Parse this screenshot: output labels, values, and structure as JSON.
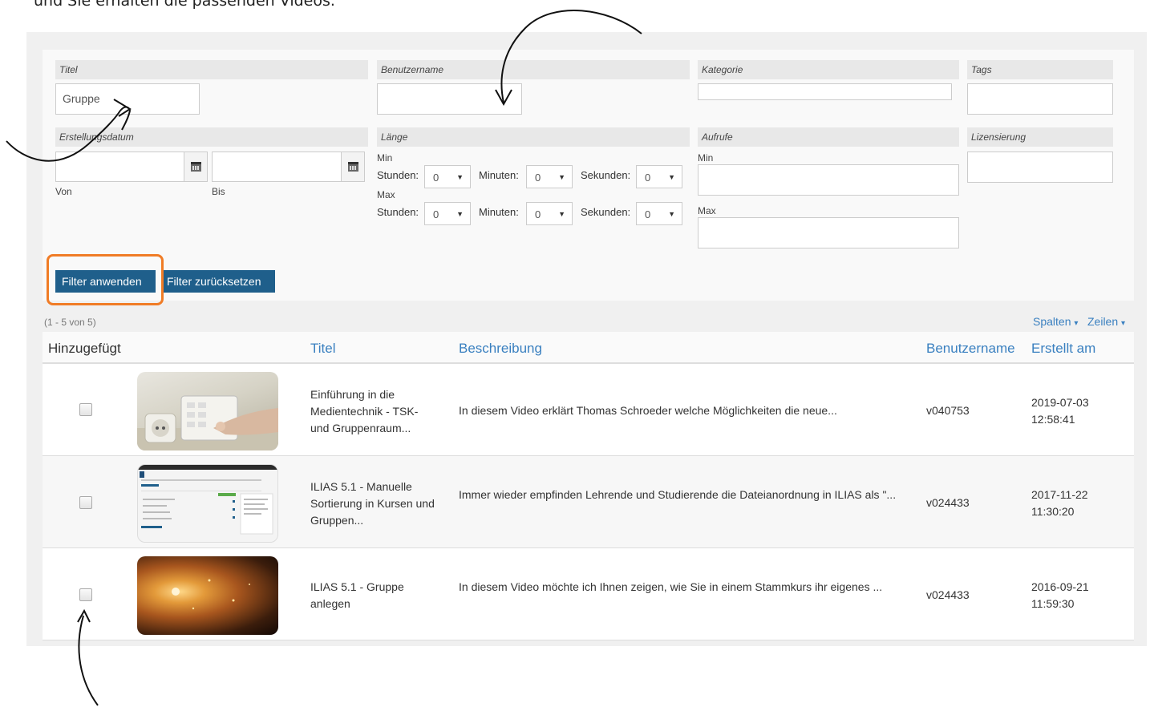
{
  "intro_text": "und Sie erhalten die passenden Videos.",
  "filter": {
    "title_label": "Titel",
    "title_value": "Gruppe",
    "username_label": "Benutzername",
    "username_value": "",
    "category_label": "Kategorie",
    "tags_label": "Tags",
    "created_label": "Erstellungsdatum",
    "from_label": "Von",
    "to_label": "Bis",
    "length_label": "Länge",
    "min_label": "Min",
    "max_label": "Max",
    "hours_label": "Stunden:",
    "minutes_label": "Minuten:",
    "seconds_label": "Sekunden:",
    "min_hours": "0",
    "min_minutes": "0",
    "min_seconds": "0",
    "max_hours": "0",
    "max_minutes": "0",
    "max_seconds": "0",
    "views_label": "Aufrufe",
    "views_min_label": "Min",
    "views_max_label": "Max",
    "license_label": "Lizensierung",
    "apply_label": "Filter anwenden",
    "reset_label": "Filter zurücksetzen"
  },
  "table": {
    "count": "(1 - 5 von 5)",
    "columns_label": "Spalten",
    "rows_label": "Zeilen",
    "headers": [
      "Hinzugefügt",
      "Titel",
      "Beschreibung",
      "Benutzername",
      "Erstellt am"
    ],
    "rows": [
      {
        "title": "Einführung in die Medientechnik - TSK- und Gruppenraum...",
        "description": "In diesem Video erklärt Thomas Schroeder welche Möglichkeiten die neue...",
        "username": "v040753",
        "date": "2019-07-03",
        "time": "12:58:41"
      },
      {
        "title": "ILIAS 5.1 - Manuelle Sortierung in Kursen und Gruppen...",
        "description": "Immer wieder empfinden Lehrende und Studierende die Dateianordnung in ILIAS als \"...",
        "username": "v024433",
        "date": "2017-11-22",
        "time": "11:30:20"
      },
      {
        "title": "ILIAS 5.1 - Gruppe anlegen",
        "description": "In diesem Video möchte ich Ihnen zeigen, wie Sie in einem Stammkurs ihr eigenes ...",
        "username": "v024433",
        "date": "2016-09-21",
        "time": "11:59:30"
      }
    ]
  },
  "colors": {
    "button": "#1f5f8b",
    "highlight": "#f07c26",
    "link": "#3a80c0"
  },
  "icons": [
    "calendar-icon",
    "caret-down-icon",
    "checkbox"
  ]
}
